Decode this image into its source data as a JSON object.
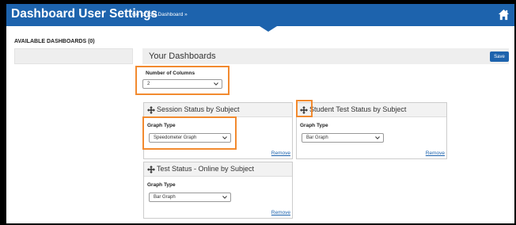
{
  "header": {
    "title": "Dashboard User Settings",
    "goto_link": "Go to Your Dashboard »",
    "home_icon": "home-icon",
    "bg_color": "#1d63ad"
  },
  "available": {
    "label": "AVAILABLE DASHBOARDS (0)"
  },
  "your_dashboards": {
    "title": "Your Dashboards",
    "save_label": "Save",
    "columns_label": "Number of Columns",
    "columns_value": "2"
  },
  "cards": [
    {
      "title": "Session Status by Subject",
      "graph_type_label": "Graph Type",
      "graph_type_value": "Speedometer Graph",
      "remove_label": "Remove"
    },
    {
      "title": "Student Test Status by Subject",
      "graph_type_label": "Graph Type",
      "graph_type_value": "Bar Graph",
      "remove_label": "Remove"
    },
    {
      "title": "Test Status - Online by Subject",
      "graph_type_label": "Graph Type",
      "graph_type_value": "Bar Graph",
      "remove_label": "Remove"
    }
  ],
  "highlight_color": "#f28a2f"
}
